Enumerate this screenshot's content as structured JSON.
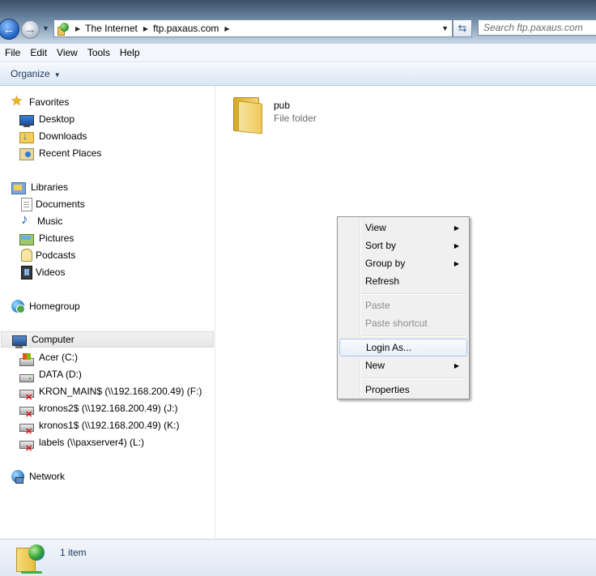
{
  "address": {
    "crumbs": [
      "The Internet",
      "ftp.paxaus.com"
    ]
  },
  "search": {
    "placeholder": "Search ftp.paxaus.com"
  },
  "menu": [
    "File",
    "Edit",
    "View",
    "Tools",
    "Help"
  ],
  "toolbar": {
    "organize_label": "Organize"
  },
  "nav": {
    "favorites": {
      "label": "Favorites",
      "items": [
        "Desktop",
        "Downloads",
        "Recent Places"
      ]
    },
    "libraries": {
      "label": "Libraries",
      "items": [
        "Documents",
        "Music",
        "Pictures",
        "Podcasts",
        "Videos"
      ]
    },
    "homegroup": {
      "label": "Homegroup"
    },
    "computer": {
      "label": "Computer",
      "items": [
        "Acer (C:)",
        "DATA (D:)",
        "KRON_MAIN$ (\\\\192.168.200.49) (F:)",
        "kronos2$ (\\\\192.168.200.49) (J:)",
        "kronos1$ (\\\\192.168.200.49) (K:)",
        "labels (\\\\paxserver4) (L:)"
      ]
    },
    "network": {
      "label": "Network"
    }
  },
  "content": {
    "items": [
      {
        "name": "pub",
        "type": "File folder"
      }
    ]
  },
  "context_menu": {
    "items": [
      {
        "label": "View",
        "submenu": true
      },
      {
        "label": "Sort by",
        "submenu": true
      },
      {
        "label": "Group by",
        "submenu": true
      },
      {
        "label": "Refresh"
      },
      {
        "label": "Paste",
        "disabled": true
      },
      {
        "label": "Paste shortcut",
        "disabled": true
      },
      {
        "label": "Login As...",
        "highlighted": true
      },
      {
        "label": "New",
        "submenu": true
      },
      {
        "label": "Properties"
      }
    ]
  },
  "status": {
    "count": "1 item"
  },
  "colors": {
    "accent": "#1e395b",
    "selection_border": "#a8c6ea",
    "disabled_text": "#8d8d8d"
  }
}
